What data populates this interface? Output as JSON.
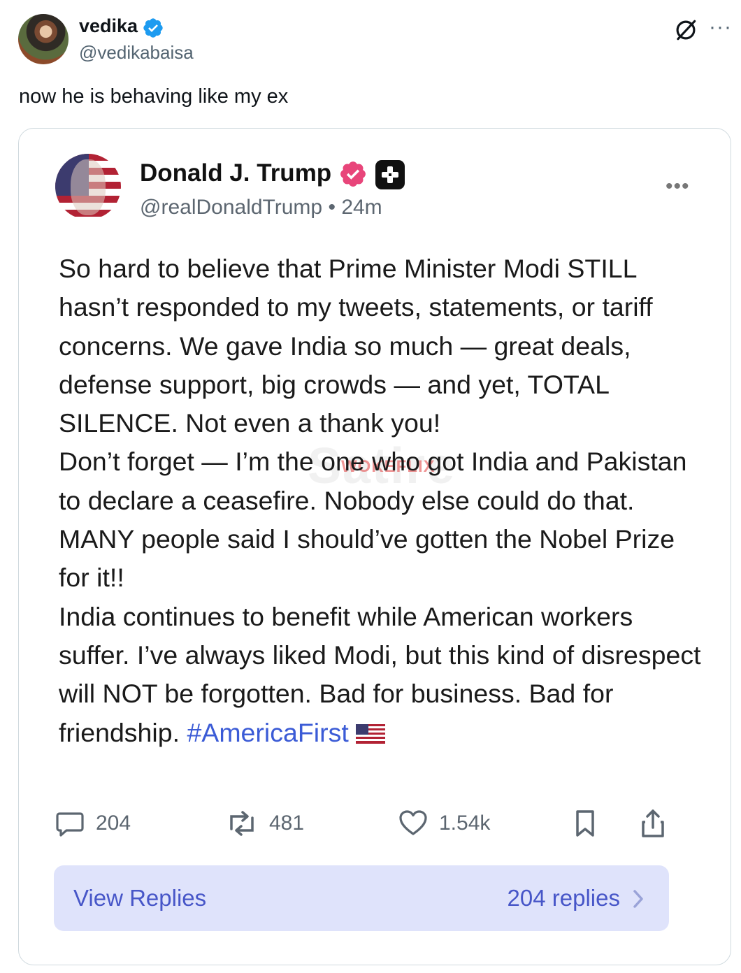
{
  "outer_tweet": {
    "display_name": "vedika",
    "handle": "@vedikabaisa",
    "text": "now he is behaving like my ex",
    "icons": [
      "verified-badge-icon",
      "grok-icon",
      "more-icon"
    ]
  },
  "embedded_post": {
    "display_name": "Donald J. Trump",
    "handle": "@realDonaldTrump",
    "separator": "•",
    "time": "24m",
    "paragraphs": [
      "So hard to believe that Prime Minister Modi STILL hasn’t responded to my tweets, statements, or tariff concerns. We gave India so much — great deals, defense support, big crowds — and yet, TOTAL SILENCE. Not even a thank you!",
      "Don’t forget — I’m the one who got India and Pakistan to declare a ceasefire. Nobody else could do that. MANY people said I should’ve gotten the Nobel Prize for it!!",
      "India continues to benefit while American workers suffer. I’ve always liked Modi, but this kind of disrespect will NOT be forgotten. Bad for business. Bad for friendship."
    ],
    "hashtag": "#AmericaFirst",
    "watermark_large": "Satire",
    "watermark_small": "WOKEFLIX",
    "actions": {
      "replies": "204",
      "reposts": "481",
      "likes": "1.54k"
    },
    "view_replies": {
      "label": "View Replies",
      "count": "204 replies"
    },
    "colors": {
      "verified_pink": "#e8457a",
      "link_blue": "#3b5bd6",
      "replies_bg": "#dfe3fb",
      "x_verified_blue": "#1d9bf0"
    }
  }
}
